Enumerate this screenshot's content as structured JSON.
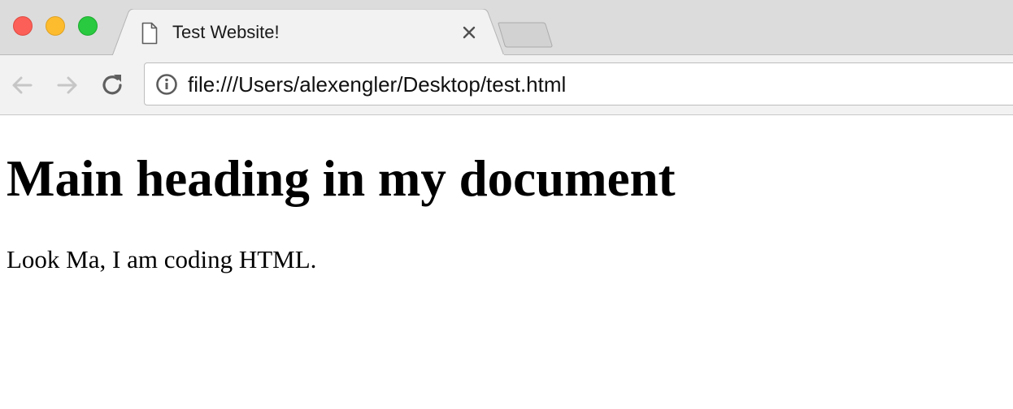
{
  "window": {
    "traffic_lights": [
      {
        "name": "close",
        "color": "#fc5f57"
      },
      {
        "name": "minimize",
        "color": "#fdbc2e"
      },
      {
        "name": "zoom",
        "color": "#29c940"
      }
    ]
  },
  "tabs": [
    {
      "title": "Test Website!",
      "favicon": "document-icon",
      "close_icon": "close-icon",
      "active": true
    }
  ],
  "new_tab": {
    "icon": "new-tab-icon"
  },
  "toolbar": {
    "back_icon": "back-arrow-icon",
    "forward_icon": "forward-arrow-icon",
    "reload_icon": "reload-icon",
    "back_enabled": false,
    "forward_enabled": false
  },
  "address_bar": {
    "security_icon": "info-icon",
    "url": "file:///Users/alexengler/Desktop/test.html"
  },
  "page": {
    "heading": "Main heading in my document",
    "paragraph": "Look Ma, I am coding HTML."
  }
}
